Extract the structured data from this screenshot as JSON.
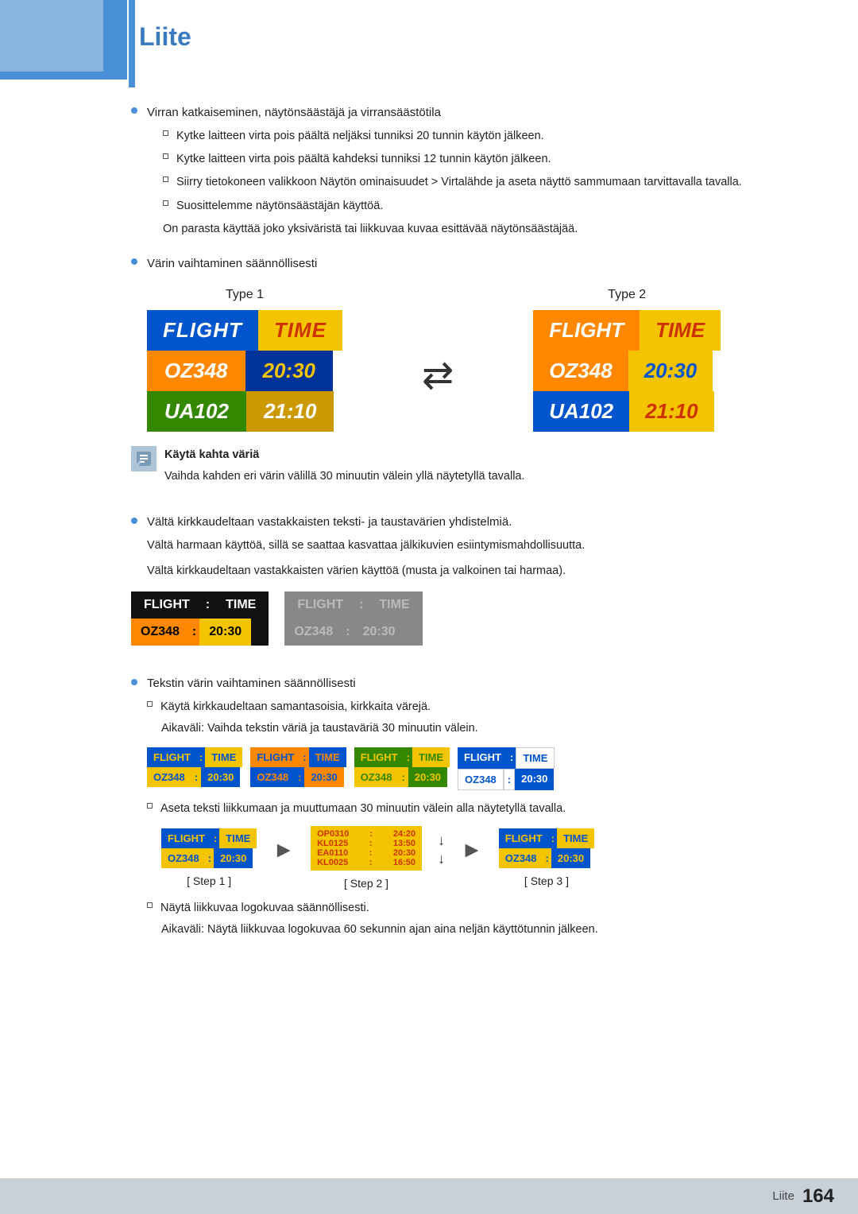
{
  "page": {
    "title": "Liite",
    "footer_label": "Liite",
    "footer_page": "164"
  },
  "content": {
    "bullet1": {
      "main": "Virran katkaiseminen, näytönsäästäjä ja virransäästötila",
      "sub": [
        "Kytke laitteen virta pois päältä neljäksi tunniksi 20 tunnin käytön jälkeen.",
        "Kytke laitteen virta pois päältä kahdeksi tunniksi 12 tunnin käytön jälkeen.",
        "Siirry tietokoneen valikkoon Näytön ominaisuudet > Virtalähde ja aseta näyttö sammumaan tarvittavalla tavalla.",
        "Suosittelemme näytönsäästäjän käyttöä.",
        "On parasta käyttää joko yksiväristä tai liikkuvaa kuvaa esittävää näytönsäästäjää."
      ]
    },
    "bullet2": {
      "main": "Värin vaihtaminen säännöllisesti"
    },
    "type1_label": "Type 1",
    "type2_label": "Type 2",
    "flight_label": "FLIGHT",
    "time_label": "TIME",
    "oz348": "OZ348",
    "time1": "20:30",
    "ua102": "UA102",
    "time2": "21:10",
    "note1": "Käytä kahta väriä",
    "note2": "Vaihda kahden eri värin välillä 30 minuutin välein yllä näytetyllä tavalla.",
    "bullet3": {
      "main": "Vältä kirkkaudeltaan vastakkaisten teksti- ja taustavärien yhdistelmiä.",
      "line2": "Vältä harmaan käyttöä, sillä se saattaa kasvattaa jälkikuvien esiintymismahdollisuutta.",
      "line3": "Vältä kirkkaudeltaan vastakkaisten värien käyttöä (musta ja valkoinen tai harmaa)."
    },
    "bullet4": {
      "main": "Tekstin värin vaihtaminen säännöllisesti",
      "sub1": "Käytä kirkkaudeltaan samantasoisia, kirkkaita värejä.",
      "sub1_indent": "Aikaväli: Vaihda tekstin väriä ja taustaväriä 30 minuutin välein.",
      "sub2": "Aseta teksti liikkumaan ja muuttumaan 30 minuutin välein alla näytetyllä tavalla.",
      "sub3": "Näytä liikkuvaa logokuvaa säännöllisesti.",
      "sub3_indent": "Aikaväli: Näytä liikkuvaa logokuvaa 60 sekunnin ajan aina neljän käyttötunnin jälkeen."
    },
    "step1": "[ Step 1 ]",
    "step2": "[ Step 2 ]",
    "step3": "[ Step 3 ]",
    "scroll_lines": [
      "OP0310 : 24:20",
      "KL0125 : 13:50",
      "EA0110 : 20:30",
      "KL0025 : 16:50"
    ]
  }
}
